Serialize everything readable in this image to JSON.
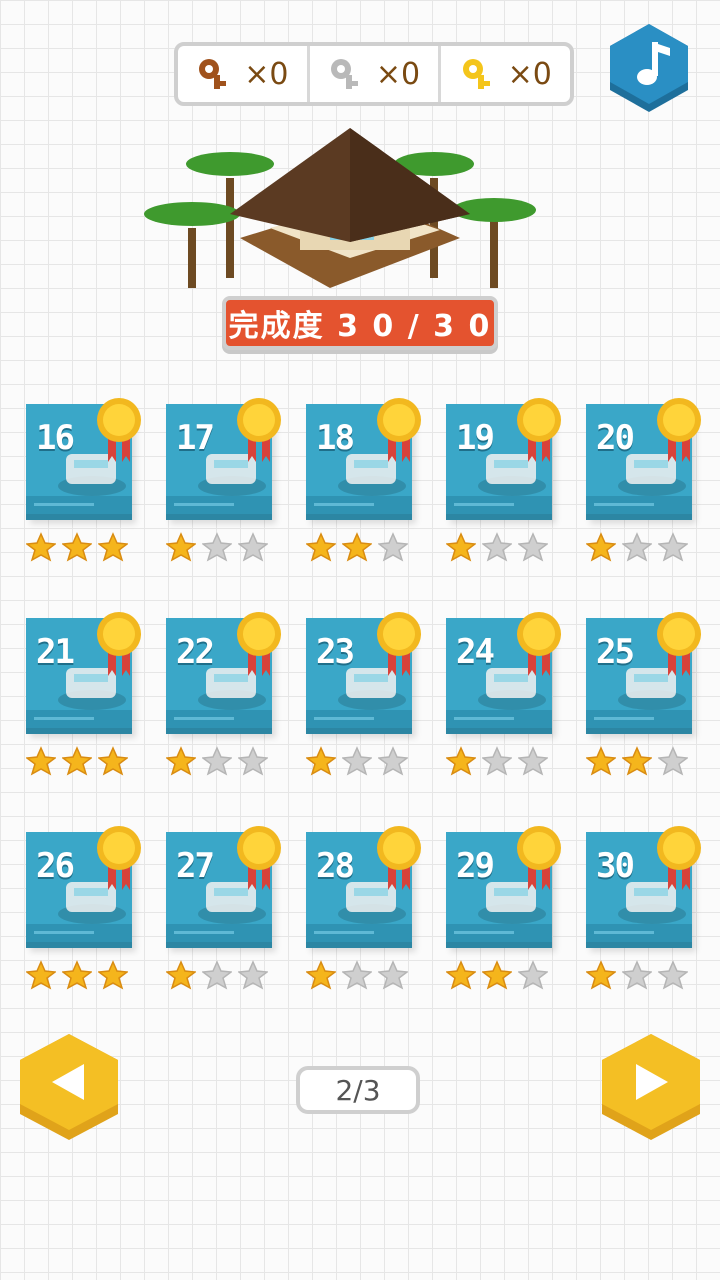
{
  "keys": [
    {
      "icon": "bronze-key-icon",
      "color": "#a0521c",
      "count": "×0"
    },
    {
      "icon": "silver-key-icon",
      "color": "#b9b9b9",
      "count": "×0"
    },
    {
      "icon": "gold-key-icon",
      "color": "#f4c51b",
      "count": "×0"
    }
  ],
  "progress": {
    "label": "完成度 3 0 / 3 0"
  },
  "levels": [
    {
      "num": "16",
      "stars": 3
    },
    {
      "num": "17",
      "stars": 1
    },
    {
      "num": "18",
      "stars": 2
    },
    {
      "num": "19",
      "stars": 1
    },
    {
      "num": "20",
      "stars": 1
    },
    {
      "num": "21",
      "stars": 3
    },
    {
      "num": "22",
      "stars": 1
    },
    {
      "num": "23",
      "stars": 1
    },
    {
      "num": "24",
      "stars": 1
    },
    {
      "num": "25",
      "stars": 2
    },
    {
      "num": "26",
      "stars": 3
    },
    {
      "num": "27",
      "stars": 1
    },
    {
      "num": "28",
      "stars": 1
    },
    {
      "num": "29",
      "stars": 2
    },
    {
      "num": "30",
      "stars": 1
    }
  ],
  "pagination": {
    "label": "2/3"
  },
  "colors": {
    "card": "#3aa7c8",
    "star_on": "#f5b51c",
    "star_off": "#cfcfcf",
    "banner": "#e4532f",
    "nav": "#f4bf24"
  }
}
